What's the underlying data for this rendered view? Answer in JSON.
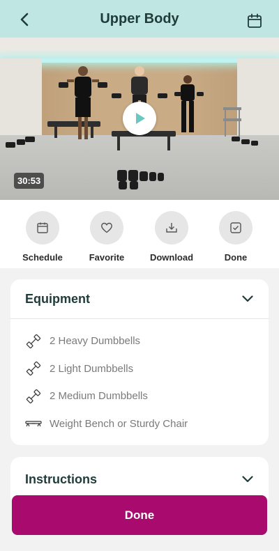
{
  "header": {
    "title": "Upper Body",
    "back_icon": "chevron-left-icon",
    "calendar_icon": "calendar-icon",
    "background": "#bfe6e3"
  },
  "video": {
    "duration": "30:53",
    "play_icon": "play-icon",
    "play_color": "#6cc7c1"
  },
  "actions": [
    {
      "label": "Schedule",
      "icon": "calendar-icon"
    },
    {
      "label": "Favorite",
      "icon": "heart-icon"
    },
    {
      "label": "Download",
      "icon": "download-icon"
    },
    {
      "label": "Done",
      "icon": "checkbox-icon"
    }
  ],
  "equipment": {
    "title": "Equipment",
    "items": [
      {
        "label": "2 Heavy Dumbbells",
        "icon": "dumbbell-icon"
      },
      {
        "label": "2 Light Dumbbells",
        "icon": "dumbbell-icon"
      },
      {
        "label": "2 Medium Dumbbells",
        "icon": "dumbbell-icon"
      },
      {
        "label": "Weight Bench or Sturdy Chair",
        "icon": "bench-icon"
      }
    ]
  },
  "instructions": {
    "title": "Instructions"
  },
  "done_button": {
    "label": "Done",
    "color": "#a80a6e"
  }
}
